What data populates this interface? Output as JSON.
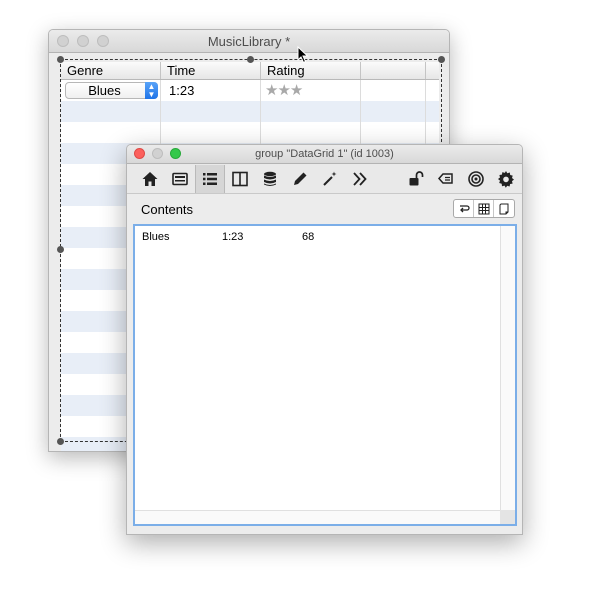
{
  "back_window": {
    "title": "MusicLibrary *",
    "columns": [
      "Genre",
      "Time",
      "Rating"
    ],
    "row": {
      "genre": "Blues",
      "time": "1:23",
      "rating": "★★★",
      "rating_stars": 3
    }
  },
  "front_window": {
    "title": "group \"DataGrid 1\" (id 1003)",
    "contents_label": "Contents",
    "contents_row": [
      "Blues",
      "1:23",
      "68"
    ]
  },
  "colors": {
    "accent": "#1f74e8",
    "selection_border": "#7baee8",
    "stripe": "#e8eef7"
  }
}
